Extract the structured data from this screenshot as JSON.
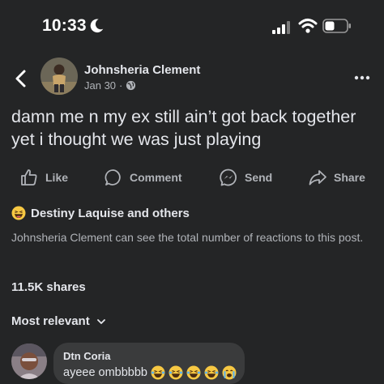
{
  "status_bar": {
    "time": "10:33",
    "icons": [
      "moon-icon",
      "signal-icon",
      "wifi-icon",
      "battery-icon"
    ]
  },
  "post": {
    "author": "Johnsheria Clement",
    "date": "Jan 30",
    "separator": "·",
    "audience_icon": "globe-icon",
    "text": "damn me n my ex still ain’t got back together yet i thought we was just playing"
  },
  "actions": {
    "like": "Like",
    "comment": "Comment",
    "send": "Send",
    "share": "Share"
  },
  "reactions": {
    "emoji": "laughing-emoji",
    "summary": "Destiny Laquise and others",
    "note": "Johnsheria Clement can see the total number of reactions to this post."
  },
  "shares": "11.5K shares",
  "sort": {
    "label": "Most relevant"
  },
  "comment": {
    "name": "Dtn Coria",
    "text": "ayeee ombbbbb",
    "emojis": [
      "laughing-emoji",
      "laughing-emoji",
      "laughing-emoji",
      "laughing-emoji",
      "crying-laughing-emoji"
    ]
  },
  "colors": {
    "background": "#242526",
    "text": "#e4e6eb",
    "secondary": "#b0b3b8",
    "bubble": "#3a3b3c"
  }
}
